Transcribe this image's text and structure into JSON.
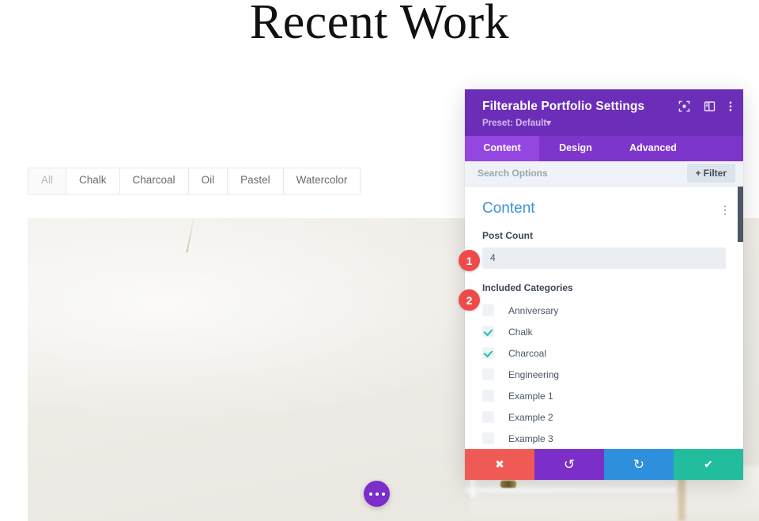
{
  "page": {
    "title": "Recent Work",
    "filter_tabs": [
      {
        "label": "All",
        "active": true
      },
      {
        "label": "Chalk",
        "active": false
      },
      {
        "label": "Charcoal",
        "active": false
      },
      {
        "label": "Oil",
        "active": false
      },
      {
        "label": "Pastel",
        "active": false
      },
      {
        "label": "Watercolor",
        "active": false
      }
    ],
    "more_button": "more-options"
  },
  "modal": {
    "title": "Filterable Portfolio Settings",
    "preset": "Preset: Default",
    "preset_caret": "▾",
    "header_icons": [
      {
        "name": "focus-icon"
      },
      {
        "name": "panel-layout-icon"
      },
      {
        "name": "more-vertical-icon"
      }
    ],
    "tabs": [
      {
        "label": "Content",
        "active": true
      },
      {
        "label": "Design",
        "active": false
      },
      {
        "label": "Advanced",
        "active": false
      }
    ],
    "search": {
      "placeholder": "Search Options",
      "filter_button": "Filter",
      "filter_plus": "+"
    },
    "section": {
      "title": "Content",
      "post_count_label": "Post Count",
      "post_count_value": "4",
      "included_categories_label": "Included Categories",
      "categories": [
        {
          "label": "Anniversary",
          "checked": false
        },
        {
          "label": "Chalk",
          "checked": true
        },
        {
          "label": "Charcoal",
          "checked": true
        },
        {
          "label": "Engineering",
          "checked": false
        },
        {
          "label": "Example 1",
          "checked": false
        },
        {
          "label": "Example 2",
          "checked": false
        },
        {
          "label": "Example 3",
          "checked": false
        },
        {
          "label": "",
          "checked": false
        }
      ]
    },
    "footer": [
      {
        "name": "cancel",
        "icon": "✖"
      },
      {
        "name": "undo",
        "icon": "↺"
      },
      {
        "name": "redo",
        "icon": "↻"
      },
      {
        "name": "save",
        "icon": "✔"
      }
    ]
  },
  "badges": [
    {
      "number": "1"
    },
    {
      "number": "2"
    }
  ],
  "colors": {
    "modal_header": "#6c2eb9",
    "tab_active": "#9447e0",
    "tab_bar": "#7e35cc",
    "section_title": "#3e8fd8",
    "check": "#17c2a4",
    "badge": "#ef4a4a",
    "footer_cancel": "#ef5a54",
    "footer_undo": "#7b2ec8",
    "footer_redo": "#2e8fdd",
    "footer_save": "#22bd9c",
    "more_button": "#7b2ec8"
  }
}
